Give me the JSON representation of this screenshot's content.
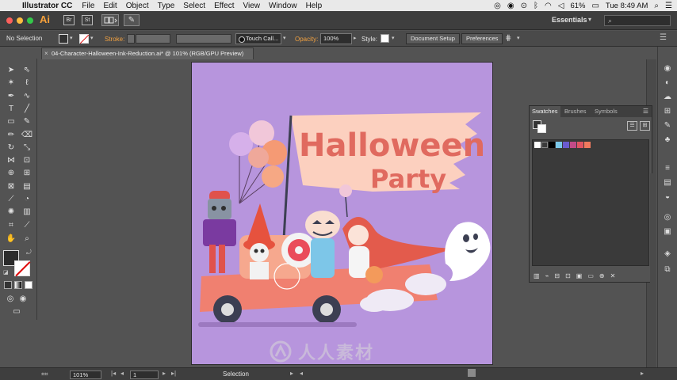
{
  "menubar": {
    "app_name": "Illustrator CC",
    "items": [
      "File",
      "Edit",
      "Object",
      "Type",
      "Select",
      "Effect",
      "View",
      "Window",
      "Help"
    ],
    "battery": "61%",
    "clock": "Tue 8:49 AM"
  },
  "appbar": {
    "logo": "Ai",
    "br_label": "Br",
    "st_label": "St",
    "workspace": "Essentials",
    "search_placeholder": ""
  },
  "controlbar": {
    "selection_label": "No Selection",
    "stroke_label": "Stroke:",
    "brush_name": "Touch Call...",
    "opacity_label": "Opacity:",
    "opacity_value": "100%",
    "style_label": "Style:",
    "document_setup": "Document Setup",
    "preferences": "Preferences"
  },
  "document": {
    "tab_title": "04-Character-Halloween-Ink-Reduction.ai* @ 101% (RGB/GPU Preview)",
    "close_symbol": "×"
  },
  "artwork": {
    "banner_line1": "Halloween",
    "banner_line2": "Party",
    "background": "#b795dd"
  },
  "swatches_panel": {
    "tabs": [
      "Swatches",
      "Brushes",
      "Symbols"
    ],
    "swatch_colors": [
      "#ffffff",
      "#000000",
      "#3a3a3a",
      "#7bc7e8",
      "#6a5bd0",
      "#c24b88",
      "#e05563",
      "#f07a5e"
    ]
  },
  "statusbar": {
    "zoom": "101%",
    "artboard_number": "1",
    "tool_status": "Selection"
  },
  "watermark": {
    "text": "人人素材"
  },
  "colors": {
    "accent_orange": "#f0a040",
    "ui_dark": "#535353"
  }
}
